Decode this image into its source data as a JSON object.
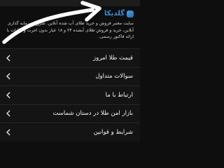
{
  "brand": {
    "name": "گلدیکا",
    "description_lines": [
      "سایت معتبر فروش و خرید طلای آب شده آنلاین. شروع سرمایه گذاری",
      "آنلاین، خرید و فروش طلای آبشده ۲۴ و ۱۸ عیار بدون اجرت و مالیات با",
      "ارائه فاکتور رسمی."
    ]
  },
  "menu": {
    "items": [
      {
        "label": "قیمت طلا امروز"
      },
      {
        "label": "سوالات متداول"
      },
      {
        "label": "ارتباط با ما"
      },
      {
        "label": "بازار امن طلا در دستان شماست"
      },
      {
        "label": "شرایط و قوانین"
      }
    ]
  },
  "colors": {
    "background": "#0e0e0e",
    "brand_blue": "#3b8fd4",
    "text": "#f2f2f2"
  },
  "icons": {
    "brand": "app-logo-icon",
    "item": "chevron-left-icon",
    "overlay": "curved-arrow-annotation"
  }
}
